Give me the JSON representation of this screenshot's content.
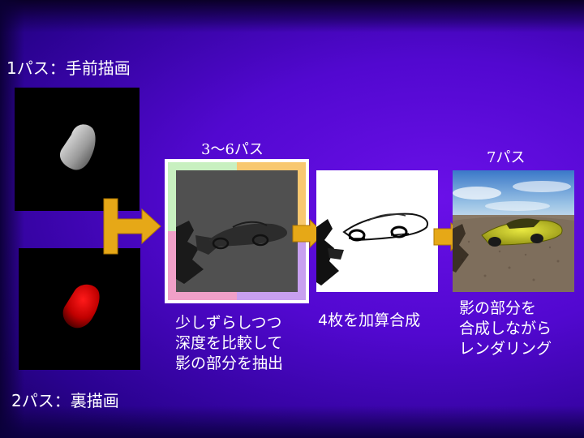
{
  "labels": {
    "pass1": "1パス：手前描画",
    "pass2": "2パス：裏描画",
    "pass3to6": "3～6パス",
    "pass7": "7パス"
  },
  "captions": {
    "shift_lines": [
      "少しずらしつつ",
      "深度を比較して",
      "影の部分を抽出"
    ],
    "accumulate": "4枚を加算合成",
    "render_lines": [
      "影の部分を",
      "合成しながら",
      "レンダリング"
    ]
  },
  "colors": {
    "arrow": "#e6a817",
    "quad_green": "#c8f0c0",
    "quad_orange": "#f8c870",
    "quad_pink": "#f0a0c8",
    "quad_purple": "#c8a0f0"
  }
}
